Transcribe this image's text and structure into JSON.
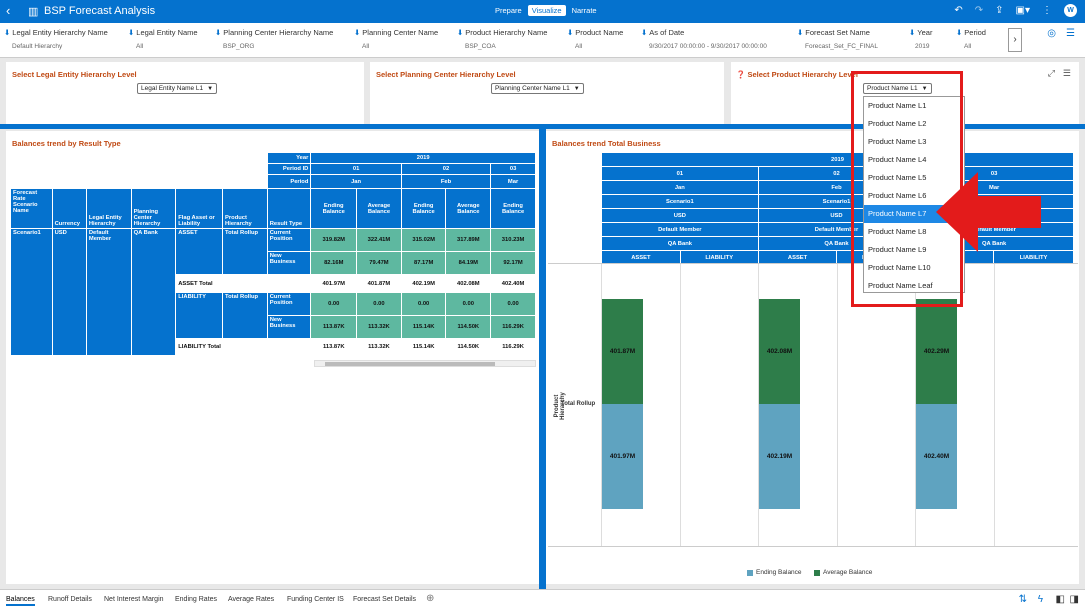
{
  "header": {
    "title": "BSP Forecast Analysis",
    "modes": [
      "Prepare",
      "Visualize",
      "Narrate"
    ],
    "active_mode": "Visualize",
    "user_initial": "W"
  },
  "filters": [
    {
      "label": "Legal Entity Hierarchy Name",
      "value": "Default Hierarchy"
    },
    {
      "label": "Legal Entity Name",
      "value": "All"
    },
    {
      "label": "Planning Center Hierarchy Name",
      "value": "BSP_ORG"
    },
    {
      "label": "Planning Center Name",
      "value": "All"
    },
    {
      "label": "Product Hierarchy Name",
      "value": "BSP_COA"
    },
    {
      "label": "Product Name",
      "value": "All"
    },
    {
      "label": "As of Date",
      "value": "9/30/2017 00:00:00 - 9/30/2017 00:00:00"
    },
    {
      "label": "Forecast Set Name",
      "value": "Forecast_Set_FC_FINAL"
    },
    {
      "label": "Year",
      "value": "2019"
    },
    {
      "label": "Period",
      "value": "All"
    }
  ],
  "selectors": {
    "legal": {
      "title": "Select Legal Entity Hierarchy Level",
      "value": "Legal Entity Name L1"
    },
    "planning": {
      "title": "Select Planning Center Hierarchy Level",
      "value": "Planning Center Name L1"
    },
    "product": {
      "title": "Select Product Hierarchy Level",
      "value": "Product Name L1"
    }
  },
  "dropdown": {
    "options": [
      "Product Name L1",
      "Product Name L2",
      "Product Name L3",
      "Product Name L4",
      "Product Name L5",
      "Product Name L6",
      "Product Name L7",
      "Product Name L8",
      "Product Name L9",
      "Product Name L10",
      "Product Name Leaf"
    ],
    "highlighted": "Product Name L7"
  },
  "table": {
    "title": "Balances trend by Result Type",
    "year_label": "Year",
    "year": "2019",
    "period_id_label": "Period ID",
    "period_label": "Period",
    "period_ids": [
      "01",
      "02",
      "03"
    ],
    "periods": [
      "Jan",
      "Feb",
      "Mar"
    ],
    "row_headers": [
      "Forecast Rate Scenario Name",
      "Currency",
      "Legal Entity Hierarchy",
      "Planning Center Hierarchy",
      "Flag Asset or Liability",
      "Product Hierarchy",
      "Result Type"
    ],
    "measure_headers": [
      "Ending Balance",
      "Average Balance",
      "Ending Balance",
      "Average Balance",
      "Ending Balance"
    ],
    "scenario": "Scenario1",
    "currency": "USD",
    "legal_entity": "Default Member",
    "planning_center": "QA Bank",
    "asset": "ASSET",
    "liability": "LIABILITY",
    "product": "Total Rollup",
    "result_types": [
      "Current Position",
      "New Business"
    ],
    "asset_rows": [
      [
        "319.82M",
        "322.41M",
        "315.02M",
        "317.89M",
        "310.23M"
      ],
      [
        "82.16M",
        "79.47M",
        "87.17M",
        "84.19M",
        "92.17M"
      ]
    ],
    "asset_total_label": "ASSET Total",
    "asset_total": [
      "401.97M",
      "401.87M",
      "402.19M",
      "402.08M",
      "402.40M"
    ],
    "liability_rows": [
      [
        "0.00",
        "0.00",
        "0.00",
        "0.00",
        "0.00"
      ],
      [
        "113.87K",
        "113.32K",
        "115.14K",
        "114.50K",
        "116.29K"
      ]
    ],
    "liability_total_label": "LIABILITY Total",
    "liability_total": [
      "113.87K",
      "113.32K",
      "115.14K",
      "114.50K",
      "116.29K"
    ]
  },
  "chart_header": {
    "year": "2019",
    "period_ids": [
      "01",
      "02",
      "03"
    ],
    "periods": [
      "Jan",
      "Feb",
      "Mar"
    ],
    "scenario": "Scenario1",
    "currency": "USD",
    "legal_entity": "Default Member",
    "planning_center": "QA Bank",
    "asset": "ASSET",
    "liability": "LIABILITY"
  },
  "chart_data": {
    "type": "bar",
    "title": "Balances trend Total Business",
    "ylabel": "Product Hierarchy",
    "category": "Total Rollup",
    "groups": [
      "01 ASSET",
      "02 ASSET",
      "03 ASSET"
    ],
    "series": [
      {
        "name": "Ending Balance",
        "values": [
          "401.97M",
          "402.19M",
          "402.40M"
        ],
        "color": "#5fa3c0"
      },
      {
        "name": "Average Balance",
        "values": [
          "401.87M",
          "402.08M",
          "402.29M"
        ],
        "color": "#2e7d4a"
      }
    ]
  },
  "bottom_tabs": [
    "Balances",
    "Runoff Details",
    "Net Interest Margin",
    "Ending Rates",
    "Average Rates",
    "Funding Center IS",
    "Forecast Set Details"
  ],
  "active_tab": "Balances",
  "colors": {
    "accent": "#0572ce",
    "title": "#c04a14",
    "highlight": "#e31b1b"
  }
}
